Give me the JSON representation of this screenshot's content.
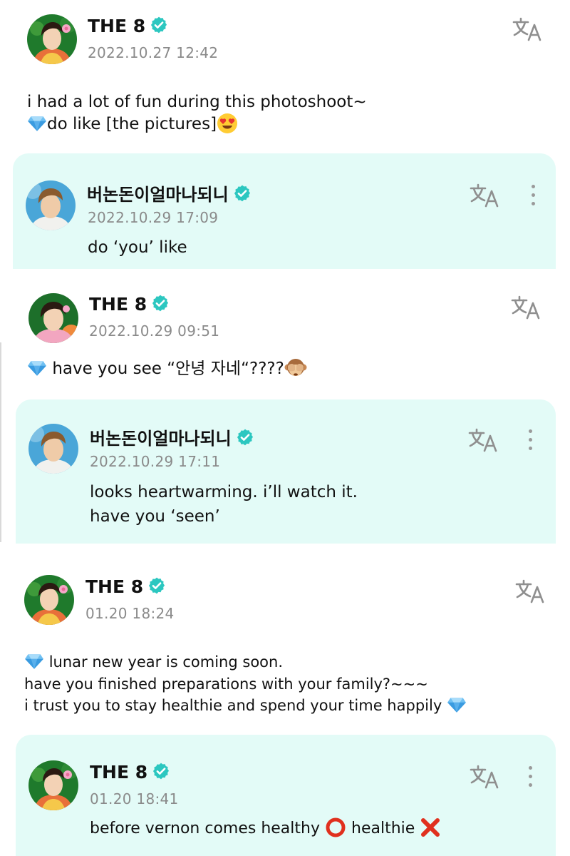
{
  "posts": [
    {
      "author": "THE 8",
      "date": "2022.10.27 12:42",
      "line1": "i had a lot of fun during this photoshoot~",
      "line2": "do like [the pictures]",
      "reply": {
        "author": "버논돈이얼마나되니",
        "date": "2022.10.29 17:09",
        "line1": "do ‘you’ like"
      }
    },
    {
      "author": "THE 8",
      "date": "2022.10.29 09:51",
      "line1": "have you see “안녕 자네“????",
      "reply": {
        "author": "버논돈이얼마나되니",
        "date": "2022.10.29 17:11",
        "line1": "looks heartwarming. i’ll watch it.",
        "line2": "have you ‘seen’"
      }
    },
    {
      "author": "THE 8",
      "date": "01.20 18:24",
      "line1": "lunar new year is coming soon.",
      "line2": "have you finished preparations with your family?~~~",
      "line3": "i trust you to stay healthie and spend your time happily",
      "reply": {
        "author": "THE 8",
        "date": "01.20 18:41",
        "line1a": "before vernon comes healthy",
        "line1b": "healthie"
      }
    }
  ],
  "icons": {
    "translate": "translate-icon",
    "verified": "verified-badge-icon",
    "more": "more-vertical-icon"
  },
  "colors": {
    "reply_bg": "#e3fbf7",
    "verified": "#2cc7c0",
    "date": "#8a8a8a"
  }
}
